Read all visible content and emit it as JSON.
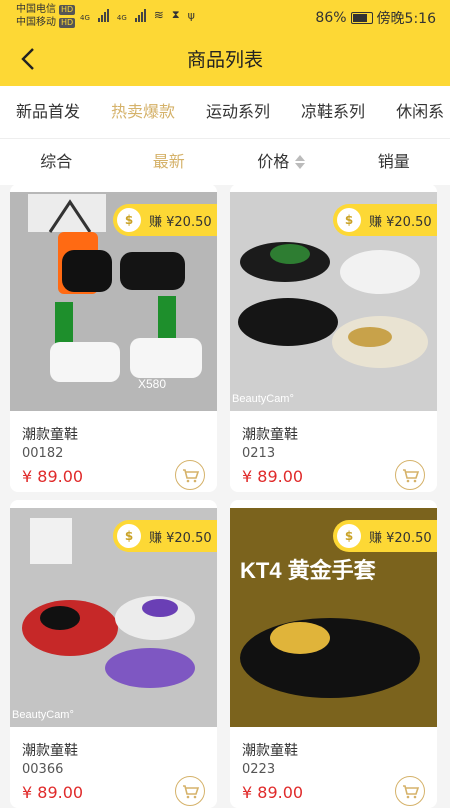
{
  "status_bar": {
    "carrier1": "中国电信",
    "carrier2": "中国移动",
    "hd": "HD",
    "net": "4G",
    "battery": "86%",
    "time": "傍晚5:16"
  },
  "header": {
    "title": "商品列表"
  },
  "tabs": [
    "新品首发",
    "热卖爆款",
    "运动系列",
    "凉鞋系列",
    "休闲系"
  ],
  "active_tab": 1,
  "sort": {
    "items": [
      "综合",
      "最新",
      "价格",
      "销量"
    ],
    "active": 1
  },
  "products": [
    {
      "badge": "赚 ¥20.50",
      "name": "潮款童鞋",
      "code": "00182",
      "price": "¥ 89.00",
      "img_label": "X580",
      "theme": "#b7b7b7"
    },
    {
      "badge": "赚 ¥20.50",
      "name": "潮款童鞋",
      "code": "0213",
      "price": "¥ 89.00",
      "img_label": "BeautyCam°",
      "theme": "#cfcfcf"
    },
    {
      "badge": "赚 ¥20.50",
      "name": "潮款童鞋",
      "code": "00366",
      "price": "¥ 89.00",
      "img_label": "BeautyCam°",
      "theme": "#c4c4c4"
    },
    {
      "badge": "赚 ¥20.50",
      "name": "潮款童鞋",
      "code": "0223",
      "price": "¥ 89.00",
      "img_label": "KT4 黄金手套",
      "theme": "#1f1f1f"
    }
  ],
  "colors": {
    "primary": "#fdd835",
    "accent": "#d5b26a",
    "price": "#e02b2b"
  }
}
